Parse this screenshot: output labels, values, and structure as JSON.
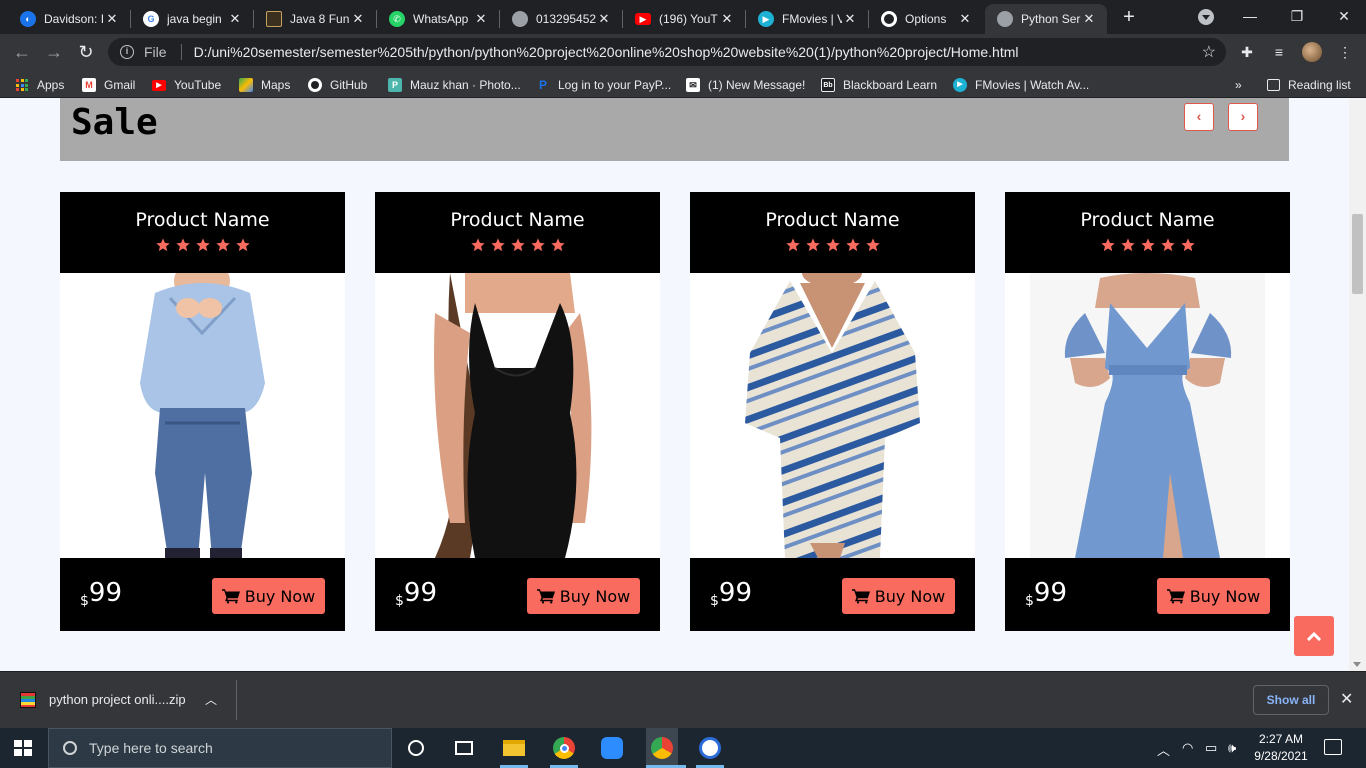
{
  "browser": {
    "tabs": [
      {
        "title": "Davidson: I",
        "icon": "davidson-icon"
      },
      {
        "title": "java begin",
        "icon": "google-icon"
      },
      {
        "title": "Java 8 Fun",
        "icon": "java-icon"
      },
      {
        "title": "WhatsApp",
        "icon": "whatsapp-icon"
      },
      {
        "title": "013295452",
        "icon": "globe-icon"
      },
      {
        "title": "(196) YouT",
        "icon": "youtube-icon"
      },
      {
        "title": "FMovies | V",
        "icon": "fmovies-icon"
      },
      {
        "title": "Options",
        "icon": "github-icon"
      },
      {
        "title": "Python Ser",
        "icon": "globe-icon"
      }
    ],
    "address": {
      "scheme_label": "File",
      "url": "D:/uni%20semester/semester%205th/python/python%20project%20online%20shop%20website%20(1)/python%20project/Home.html"
    },
    "bookmarks": [
      {
        "label": "Apps",
        "icon": "apps-grid-icon"
      },
      {
        "label": "Gmail",
        "icon": "gmail-icon"
      },
      {
        "label": "YouTube",
        "icon": "youtube-icon"
      },
      {
        "label": "Maps",
        "icon": "maps-icon"
      },
      {
        "label": "GitHub",
        "icon": "github-icon"
      },
      {
        "label": "Mauz khan · Photo...",
        "icon": "photo-icon"
      },
      {
        "label": "Log in to your PayP...",
        "icon": "paypal-icon"
      },
      {
        "label": "(1) New Message!",
        "icon": "message-icon"
      },
      {
        "label": "Blackboard Learn",
        "icon": "blackboard-icon"
      },
      {
        "label": "FMovies | Watch Av...",
        "icon": "fmovies-icon"
      }
    ],
    "bookmarks_overflow": "»",
    "reading_list": "Reading list"
  },
  "page": {
    "section_title": "Sale",
    "accent_color": "#f96b5f",
    "products": [
      {
        "name": "Product Name",
        "rating": 5,
        "currency": "$",
        "price": "99",
        "button": "Buy Now",
        "image": "boy-blue-shirt-jeans"
      },
      {
        "name": "Product Name",
        "rating": 5,
        "currency": "$",
        "price": "99",
        "button": "Buy Now",
        "image": "black-dress"
      },
      {
        "name": "Product Name",
        "rating": 5,
        "currency": "$",
        "price": "99",
        "button": "Buy Now",
        "image": "tie-dye-kaftan"
      },
      {
        "name": "Product Name",
        "rating": 5,
        "currency": "$",
        "price": "99",
        "button": "Buy Now",
        "image": "blue-maxi-dress"
      }
    ]
  },
  "download": {
    "filename": "python project onli....zip",
    "show_all": "Show all"
  },
  "taskbar": {
    "search_placeholder": "Type here to search",
    "time": "2:27 AM",
    "date": "9/28/2021"
  }
}
